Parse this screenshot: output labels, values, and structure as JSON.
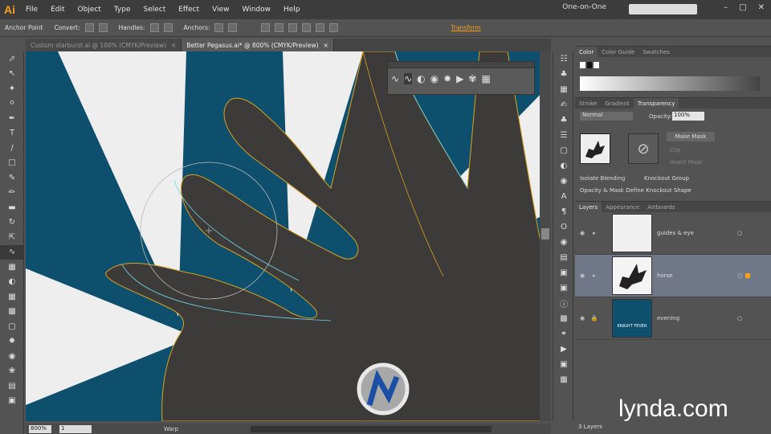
{
  "app": {
    "logo": "Ai",
    "workspace": "One-on-One"
  },
  "menu": [
    "File",
    "Edit",
    "Object",
    "Type",
    "Select",
    "Effect",
    "View",
    "Window",
    "Help"
  ],
  "control_bar": {
    "anchor_point": "Anchor Point",
    "convert": "Convert:",
    "handles": "Handles:",
    "anchors": "Anchors:",
    "transform": "Transform"
  },
  "doc_tabs": [
    {
      "label": "Custom starburst.ai @ 100% (CMYK/Preview)"
    },
    {
      "label": "Better Pegasus.ai* @ 800% (CMYK/Preview)"
    }
  ],
  "status": {
    "zoom": "800%",
    "page": "1",
    "tool_name": "Warp"
  },
  "color_panel": {
    "tabs": [
      "Color",
      "Color Guide",
      "Swatches"
    ]
  },
  "transparency_panel": {
    "tabs": [
      "Stroke",
      "Gradient",
      "Transparency"
    ],
    "blend_mode": "Normal",
    "opacity_label": "Opacity:",
    "opacity": "100%",
    "make_mask": "Make Mask",
    "clip": "Clip",
    "invert_mask": "Invert Mask",
    "isolate_blending": "Isolate Blending",
    "knockout_group": "Knockout Group",
    "opacity_mask": "Opacity & Mask Define Knockout Shape"
  },
  "layers_panel": {
    "tabs": [
      "Layers",
      "Appearance",
      "Artboards"
    ],
    "layers": [
      {
        "name": "guides & eye"
      },
      {
        "name": "horse"
      },
      {
        "name": "evening"
      }
    ],
    "evening_thumb_text": "KNIGHT FEVER",
    "count": "3 Layers"
  },
  "watermark": "lynda.com",
  "colors": {
    "accent": "#f7a11a",
    "canvas_bg": "#0e4f6d",
    "shape": "#3d3a3a",
    "selection": "#6f7788"
  }
}
